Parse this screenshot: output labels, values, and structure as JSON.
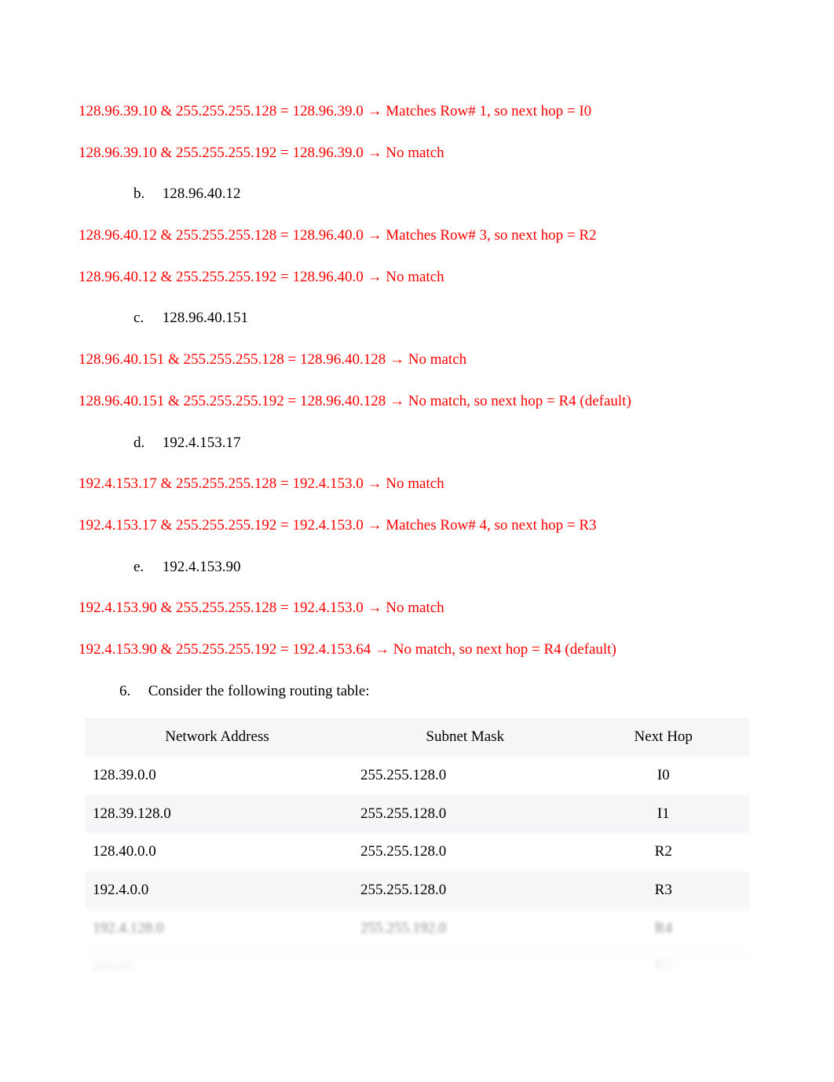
{
  "lines": {
    "a1": "128.96.39.10 & 255.255.255.128 = 128.96.39.0  →  Matches Row# 1, so next hop = I0",
    "a2": "128.96.39.10 & 255.255.255.192 = 128.96.39.0  →  No match",
    "b_marker": "b.",
    "b_label": "128.96.40.12",
    "b1": "128.96.40.12 & 255.255.255.128 = 128.96.40.0  →  Matches Row# 3, so next hop = R2",
    "b2": "128.96.40.12 & 255.255.255.192 = 128.96.40.0  →  No match",
    "c_marker": "c.",
    "c_label": "128.96.40.151",
    "c1": "128.96.40.151 & 255.255.255.128 = 128.96.40.128  → No match",
    "c2": "128.96.40.151 & 255.255.255.192 = 128.96.40.128  →  No match, so next hop = R4 (default)",
    "d_marker": "d.",
    "d_label": "192.4.153.17",
    "d1": "192.4.153.17 & 255.255.255.128 = 192.4.153.0  →  No match",
    "d2": "192.4.153.17 & 255.255.255.192 = 192.4.153.0  →  Matches Row# 4, so next hop = R3",
    "e_marker": "e.",
    "e_label": "192.4.153.90",
    "e1": "192.4.153.90 & 255.255.255.128 = 192.4.153.0  →  No match",
    "e2": "192.4.153.90 & 255.255.255.192 = 192.4.153.64  →  No match, so next hop = R4 (default)",
    "q6_marker": "6.",
    "q6_label": "Consider the following routing table:"
  },
  "table": {
    "headers": {
      "col1": "Network Address",
      "col2": "Subnet Mask",
      "col3": "Next Hop"
    },
    "rows": [
      {
        "addr": "128.39.0.0",
        "mask": "255.255.128.0",
        "hop": "I0"
      },
      {
        "addr": "128.39.128.0",
        "mask": "255.255.128.0",
        "hop": "I1"
      },
      {
        "addr": "128.40.0.0",
        "mask": "255.255.128.0",
        "hop": "R2"
      },
      {
        "addr": "192.4.0.0",
        "mask": "255.255.128.0",
        "hop": "R3"
      },
      {
        "addr": "192.4.128.0",
        "mask": "255.255.192.0",
        "hop": "R4"
      },
      {
        "addr": "default",
        "mask": "",
        "hop": "R5"
      }
    ]
  }
}
